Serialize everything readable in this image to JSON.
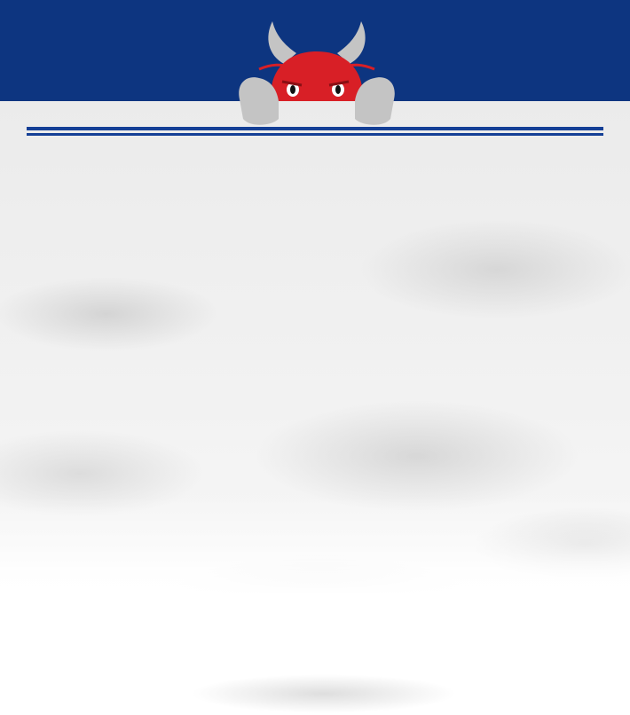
{
  "colors": {
    "brand_blue": "#0d3580",
    "rule_blue": "#143f96",
    "bull_red": "#d81f26",
    "horn_gray": "#c4c4c4",
    "paper_gray": "#eeeeee"
  },
  "icons": {
    "mascot": "bull-mascot-icon"
  }
}
